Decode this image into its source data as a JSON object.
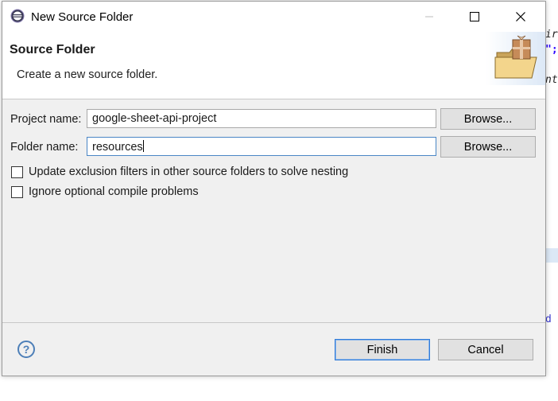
{
  "background": {
    "fragments": [
      "ira",
      "\";",
      "nt",
      "d"
    ]
  },
  "window": {
    "title": "New Source Folder"
  },
  "header": {
    "title": "Source Folder",
    "description": "Create a new source folder."
  },
  "form": {
    "project_label": "Project name:",
    "project_value": "google-sheet-api-project",
    "folder_label": "Folder name:",
    "folder_value": "resources",
    "browse_label": "Browse...",
    "checkboxes": [
      {
        "label": "Update exclusion filters in other source folders to solve nesting",
        "checked": false
      },
      {
        "label": "Ignore optional compile problems",
        "checked": false
      }
    ]
  },
  "footer": {
    "finish_label": "Finish",
    "cancel_label": "Cancel"
  },
  "colors": {
    "accent": "#2f7bd8",
    "dialog_bg": "#f0f0f0"
  }
}
